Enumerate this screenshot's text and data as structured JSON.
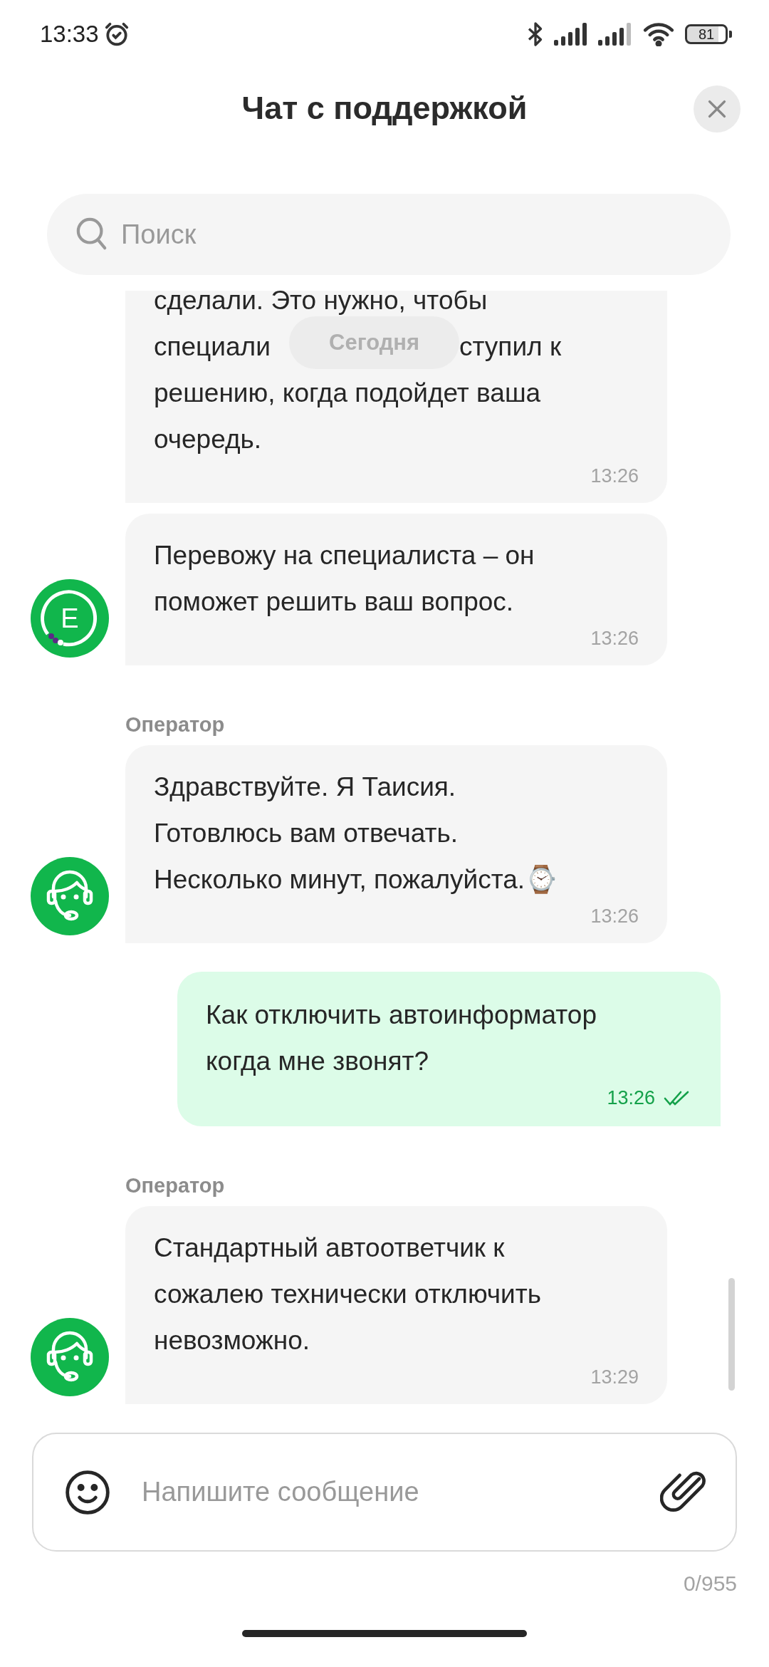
{
  "status_bar": {
    "time": "13:33",
    "battery": "81"
  },
  "header": {
    "title": "Чат с поддержкой"
  },
  "search": {
    "placeholder": "Поиск"
  },
  "date_chip": "Сегодня",
  "messages": [
    {
      "kind": "incoming",
      "lines": [
        "сделали. Это нужно, чтобы",
        [
          "специали",
          "ступил к"
        ],
        "решению, когда подойдет ваша",
        "очередь."
      ],
      "time": "13:26"
    },
    {
      "kind": "incoming",
      "avatar": {
        "kind": "bot",
        "letter": "E"
      },
      "text": "Перевожу на специалиста – он\nпоможет решить ваш вопрос.",
      "time": "13:26"
    },
    {
      "kind": "incoming",
      "avatar": {
        "kind": "operator"
      },
      "sender": "Оператор",
      "text": "Здравствуйте. Я Таисия.\nГотовлюсь вам отвечать.\nНесколько минут, пожалуйста.⌚",
      "time": "13:26"
    },
    {
      "kind": "outgoing",
      "text": "Как отключить автоинформатор\nкогда мне звонят?",
      "time": "13:26",
      "read": true
    },
    {
      "kind": "incoming",
      "avatar": {
        "kind": "operator"
      },
      "sender": "Оператор",
      "text": "Стандартный автоответчик к\nсожалею технически отключить\nневозможно.",
      "time": "13:29"
    }
  ],
  "composer": {
    "placeholder": "Напишите сообщение",
    "counter": "0/955"
  }
}
